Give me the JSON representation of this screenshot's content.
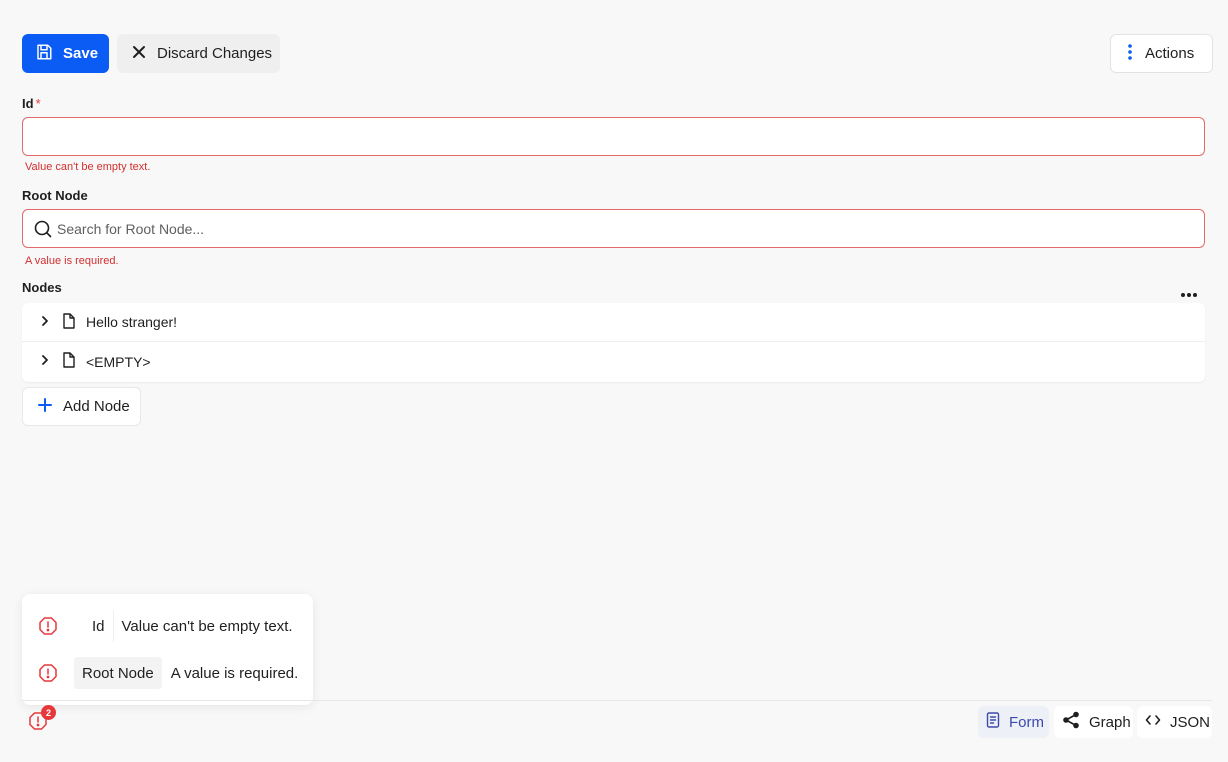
{
  "toolbar": {
    "save_label": "Save",
    "discard_label": "Discard Changes",
    "actions_label": "Actions"
  },
  "form": {
    "id": {
      "label": "Id",
      "required_marker": "*",
      "value": "",
      "error": "Value can't be empty text."
    },
    "root_node": {
      "label": "Root Node",
      "placeholder": "Search for Root Node...",
      "error": "A value is required."
    },
    "nodes": {
      "label": "Nodes",
      "items": [
        {
          "label": "Hello stranger!"
        },
        {
          "label": "<EMPTY>"
        }
      ],
      "add_label": "Add Node"
    }
  },
  "errors_popup": {
    "items": [
      {
        "field": "Id",
        "message": "Value can't be empty text."
      },
      {
        "field": "Root Node",
        "message": "A value is required."
      }
    ]
  },
  "footer": {
    "error_count": "2",
    "views": [
      {
        "label": "Form",
        "active": true
      },
      {
        "label": "Graph",
        "active": false
      },
      {
        "label": "JSON",
        "active": false
      }
    ]
  },
  "colors": {
    "primary": "#0b5cf5",
    "error": "#e5383b",
    "active_view": "#3b4aa8"
  }
}
